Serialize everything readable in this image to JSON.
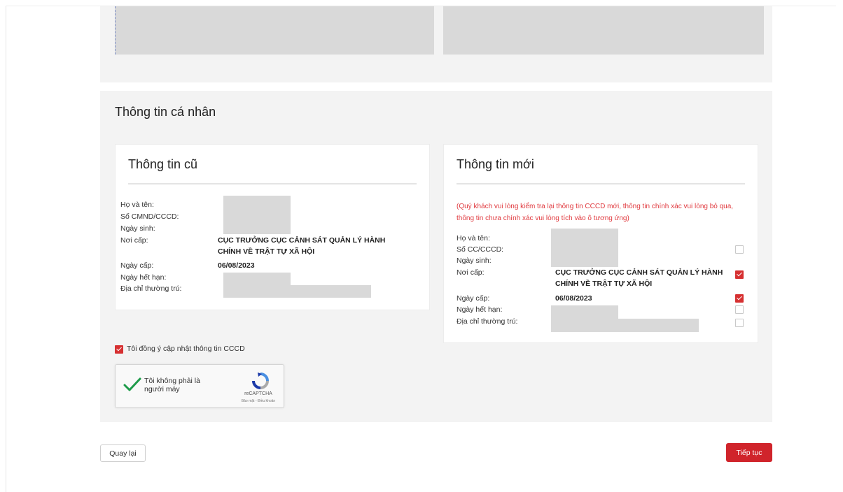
{
  "colors": {
    "accent": "#d0242b",
    "note": "#e0393e",
    "redacted": "#d9d9d9",
    "panel": "#f3f3f3"
  },
  "personal": {
    "title": "Thông tin cá nhân",
    "old": {
      "title": "Thông tin cũ",
      "fields": {
        "name_label": "Họ và tên:",
        "id_label": "Số CMND/CCCD:",
        "dob_label": "Ngày sinh:",
        "place_label": "Nơi cấp:",
        "place_value": "CỤC TRƯỞNG CỤC CẢNH SÁT QUẢN LÝ HÀNH CHÍNH VỀ TRẬT TỰ XÃ HỘI",
        "issue_label": "Ngày cấp:",
        "issue_value": "06/08/2023",
        "expiry_label": "Ngày hết hạn:",
        "address_label": "Địa chỉ thường trú:"
      }
    },
    "new": {
      "title": "Thông tin mới",
      "note": "(Quý khách vui lòng kiểm tra lại thông tin CCCD mới, thông tin chính xác vui lòng bỏ qua, thông tin chưa chính xác vui lòng tích vào ô tương ứng)",
      "fields": {
        "name_label": "Họ và tên:",
        "id_label": "Số CC/CCCD:",
        "dob_label": "Ngày sinh:",
        "place_label": "Nơi cấp:",
        "place_value": "CỤC TRƯỞNG CỤC CẢNH SÁT QUẢN LÝ HÀNH CHÍNH VỀ TRẬT TỰ XÃ HỘI",
        "issue_label": "Ngày cấp:",
        "issue_value": "06/08/2023",
        "expiry_label": "Ngày hết hạn:",
        "address_label": "Địa chỉ thường trú:"
      },
      "checks": {
        "id": false,
        "place": true,
        "issue": true,
        "expiry": false,
        "address": false
      }
    }
  },
  "agree": {
    "label": "Tôi đồng ý cập nhật thông tin CCCD",
    "checked": true
  },
  "captcha": {
    "label": "Tôi không phải là người máy",
    "brand": "reCAPTCHA",
    "links": "Bảo mật - Điều khoản",
    "verified": true
  },
  "buttons": {
    "back": "Quay lại",
    "next": "Tiếp tục"
  }
}
